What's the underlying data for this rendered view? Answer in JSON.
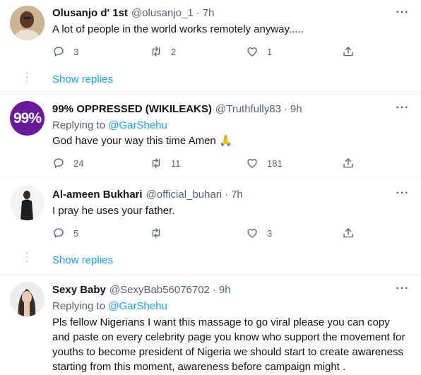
{
  "tweets": [
    {
      "name": "Olusanjo d' 1st",
      "handle": "@olusanjo_1",
      "dot": "·",
      "time": "7h",
      "text": "A lot of people in the world works remotely anyway.....",
      "replies": "3",
      "retweets": "2",
      "likes": "1",
      "show_replies": "Show replies"
    },
    {
      "name": "99% OPPRESSED (WIKILEAKS)",
      "handle": "@Truthfully83",
      "dot": "·",
      "time": "9h",
      "avatar_text": "99%",
      "replying_prefix": "Replying to",
      "replying_to": "@GarShehu",
      "text": "God have your way this time Amen 🙏",
      "replies": "24",
      "retweets": "11",
      "likes": "181"
    },
    {
      "name": "Al-ameen Bukhari",
      "handle": "@official_buhari",
      "dot": "·",
      "time": "7h",
      "text": "I pray he uses your father.",
      "replies": "5",
      "retweets": "",
      "likes": "3",
      "show_replies": "Show replies"
    },
    {
      "name": "Sexy Baby",
      "handle": "@SexyBab56076702",
      "dot": "·",
      "time": "9h",
      "replying_prefix": "Replying to",
      "replying_to": "@GarShehu",
      "text": "Pls fellow Nigerians I want this massage to go viral please you can copy and paste on every celebrity page you know who support the movement for youths to become president of Nigeria we should start to create awareness starting from this moment, awareness before campaign might ."
    }
  ],
  "more_label": "···",
  "colors": {
    "accent": "#1d9bf0",
    "muted": "#536471",
    "avatar_purple": "#6a1b9a"
  },
  "icons": [
    "reply-icon",
    "retweet-icon",
    "like-icon",
    "share-icon",
    "more-icon"
  ]
}
